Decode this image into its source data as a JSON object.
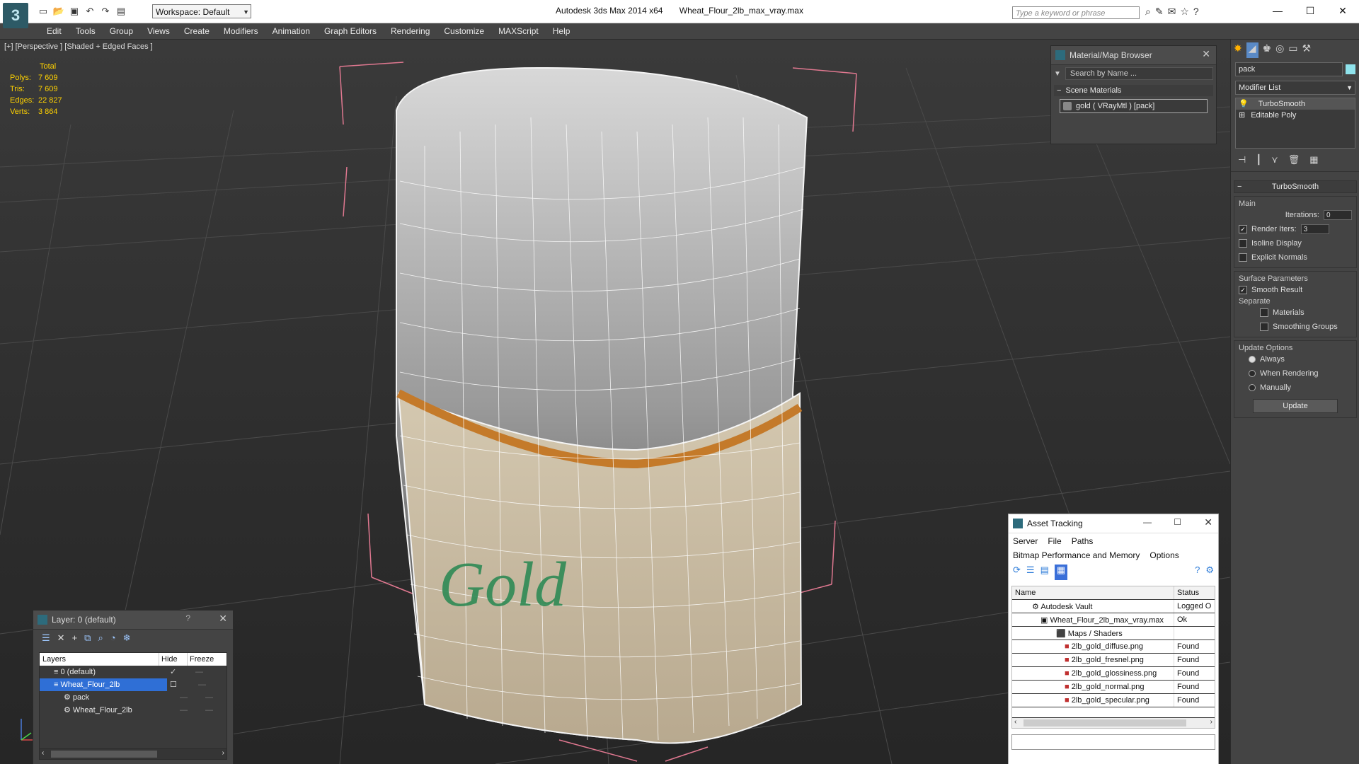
{
  "titlebar": {
    "app_title": "Autodesk 3ds Max  2014 x64",
    "file_title": "Wheat_Flour_2lb_max_vray.max",
    "workspace": "Workspace: Default",
    "search_placeholder": "Type a keyword or phrase"
  },
  "menu": [
    "Edit",
    "Tools",
    "Group",
    "Views",
    "Create",
    "Modifiers",
    "Animation",
    "Graph Editors",
    "Rendering",
    "Customize",
    "MAXScript",
    "Help"
  ],
  "viewport": {
    "label": "[+] [Perspective ] [Shaded + Edged Faces ]",
    "stats_header": "Total",
    "stats": [
      {
        "label": "Polys:",
        "value": "7 609"
      },
      {
        "label": "Tris:",
        "value": "7 609"
      },
      {
        "label": "Edges:",
        "value": "22 827"
      },
      {
        "label": "Verts:",
        "value": "3 864"
      }
    ]
  },
  "material_browser": {
    "title": "Material/Map Browser",
    "search_placeholder": "Search by Name ...",
    "section": "Scene Materials",
    "item": "gold  ( VRayMtl ) [pack]"
  },
  "right_panel": {
    "object_name": "pack",
    "modifier_list": "Modifier List",
    "stack": [
      "TurboSmooth",
      "Editable Poly"
    ],
    "rollout_title": "TurboSmooth",
    "main_label": "Main",
    "iterations_label": "Iterations:",
    "iterations_value": "0",
    "render_iters_label": "Render Iters:",
    "render_iters_value": "3",
    "isoline": "Isoline Display",
    "explicit_normals": "Explicit Normals",
    "surface_params": "Surface Parameters",
    "smooth_result": "Smooth Result",
    "separate": "Separate",
    "materials": "Materials",
    "smoothing_groups": "Smoothing Groups",
    "update_options": "Update Options",
    "always": "Always",
    "when_rendering": "When Rendering",
    "manually": "Manually",
    "update_button": "Update"
  },
  "layer_panel": {
    "title": "Layer: 0 (default)",
    "col_layers": "Layers",
    "col_hide": "Hide",
    "col_freeze": "Freeze",
    "rows": [
      {
        "name": "0 (default)",
        "indent": 1
      },
      {
        "name": "Wheat_Flour_2lb",
        "indent": 1
      },
      {
        "name": "pack",
        "indent": 2
      },
      {
        "name": "Wheat_Flour_2lb",
        "indent": 2
      }
    ]
  },
  "asset_tracking": {
    "title": "Asset Tracking",
    "menu": [
      "Server",
      "File",
      "Paths"
    ],
    "menu2": [
      "Bitmap Performance and Memory",
      "Options"
    ],
    "col_name": "Name",
    "col_status": "Status",
    "rows": [
      {
        "name": "Autodesk Vault",
        "status": "Logged O",
        "indent": 1
      },
      {
        "name": "Wheat_Flour_2lb_max_vray.max",
        "status": "Ok",
        "indent": 2
      },
      {
        "name": "Maps / Shaders",
        "status": "",
        "indent": 3
      },
      {
        "name": "2lb_gold_diffuse.png",
        "status": "Found",
        "indent": 4
      },
      {
        "name": "2lb_gold_fresnel.png",
        "status": "Found",
        "indent": 4
      },
      {
        "name": "2lb_gold_glossiness.png",
        "status": "Found",
        "indent": 4
      },
      {
        "name": "2lb_gold_normal.png",
        "status": "Found",
        "indent": 4
      },
      {
        "name": "2lb_gold_specular.png",
        "status": "Found",
        "indent": 4
      }
    ]
  }
}
